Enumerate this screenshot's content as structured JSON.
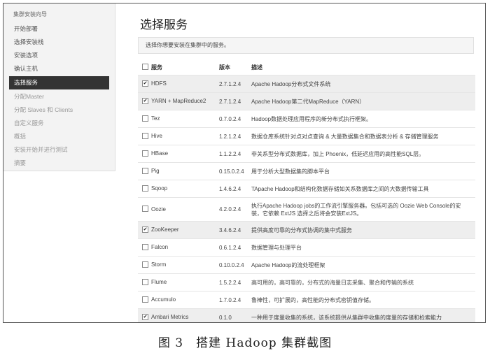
{
  "sidebar": {
    "title": "集群安装向导",
    "items": [
      {
        "label": "开始部署",
        "state": "done"
      },
      {
        "label": "选择安装栈",
        "state": "done"
      },
      {
        "label": "安装选项",
        "state": "done"
      },
      {
        "label": "确认主机",
        "state": "done"
      },
      {
        "label": "选择服务",
        "state": "active"
      },
      {
        "label": "分配Master",
        "state": "pending"
      },
      {
        "label": "分配 Slaves 和 Clients",
        "state": "pending"
      },
      {
        "label": "自定义服务",
        "state": "pending"
      },
      {
        "label": "概括",
        "state": "pending"
      },
      {
        "label": "安装开始并进行测试",
        "state": "pending"
      },
      {
        "label": "摘要",
        "state": "pending"
      }
    ]
  },
  "main": {
    "title": "选择服务",
    "notice": "选择你想要安装在集群中的服务。",
    "columns": {
      "service": "服务",
      "version": "版本",
      "description": "描述"
    },
    "services": [
      {
        "name": "HDFS",
        "version": "2.7.1.2.4",
        "description": "Apache Hadoop分布式文件系统",
        "checked": true
      },
      {
        "name": "YARN + MapReduce2",
        "version": "2.7.1.2.4",
        "description": "Apache Hadoop第二代MapReduce（YARN）",
        "checked": true
      },
      {
        "name": "Tez",
        "version": "0.7.0.2.4",
        "description": "Hadoop数据处理应用程序的新分布式执行框架。",
        "checked": false
      },
      {
        "name": "Hive",
        "version": "1.2.1.2.4",
        "description": "数据仓库系统针对点对点查询 & 大量数据集合和数据表分析 & 存储管理服务",
        "checked": false
      },
      {
        "name": "HBase",
        "version": "1.1.2.2.4",
        "description": "非关系型分布式数据库，加上 Phoenix，低延迟应用的高性能SQL层。",
        "checked": false
      },
      {
        "name": "Pig",
        "version": "0.15.0.2.4",
        "description": "用于分析大型数据集的脚本平台",
        "checked": false
      },
      {
        "name": "Sqoop",
        "version": "1.4.6.2.4",
        "description": "TApache Hadoop和结构化数据存储如关系数据库之间的大数据传输工具",
        "checked": false
      },
      {
        "name": "Oozie",
        "version": "4.2.0.2.4",
        "description": "执行Apache Hadoop jobs的工作流引擎服务器。包括可选的 Oozie Web Console的安装，它依赖 ExtJS 选择之后将会安装ExtJS。",
        "checked": false
      },
      {
        "name": "ZooKeeper",
        "version": "3.4.6.2.4",
        "description": "提供高度可靠的分布式协调的集中式服务",
        "checked": true
      },
      {
        "name": "Falcon",
        "version": "0.6.1.2.4",
        "description": "数据管理与处理平台",
        "checked": false
      },
      {
        "name": "Storm",
        "version": "0.10.0.2.4",
        "description": "Apache Hadoop的流处理框架",
        "checked": false
      },
      {
        "name": "Flume",
        "version": "1.5.2.2.4",
        "description": "高可用的，高可靠的，分布式的海量日志采集、聚合和传输的系统",
        "checked": false
      },
      {
        "name": "Accumulo",
        "version": "1.7.0.2.4",
        "description": "鲁棒性，可扩展的，高性能的分布式密钥值存储。",
        "checked": false
      },
      {
        "name": "Ambari Metrics",
        "version": "0.1.0",
        "description": "一种用于度量收集的系统，该系统提供从集群中收集的度量的存储和检索能力",
        "checked": true
      }
    ]
  },
  "caption": "图 3　搭建 Hadoop 集群截图"
}
